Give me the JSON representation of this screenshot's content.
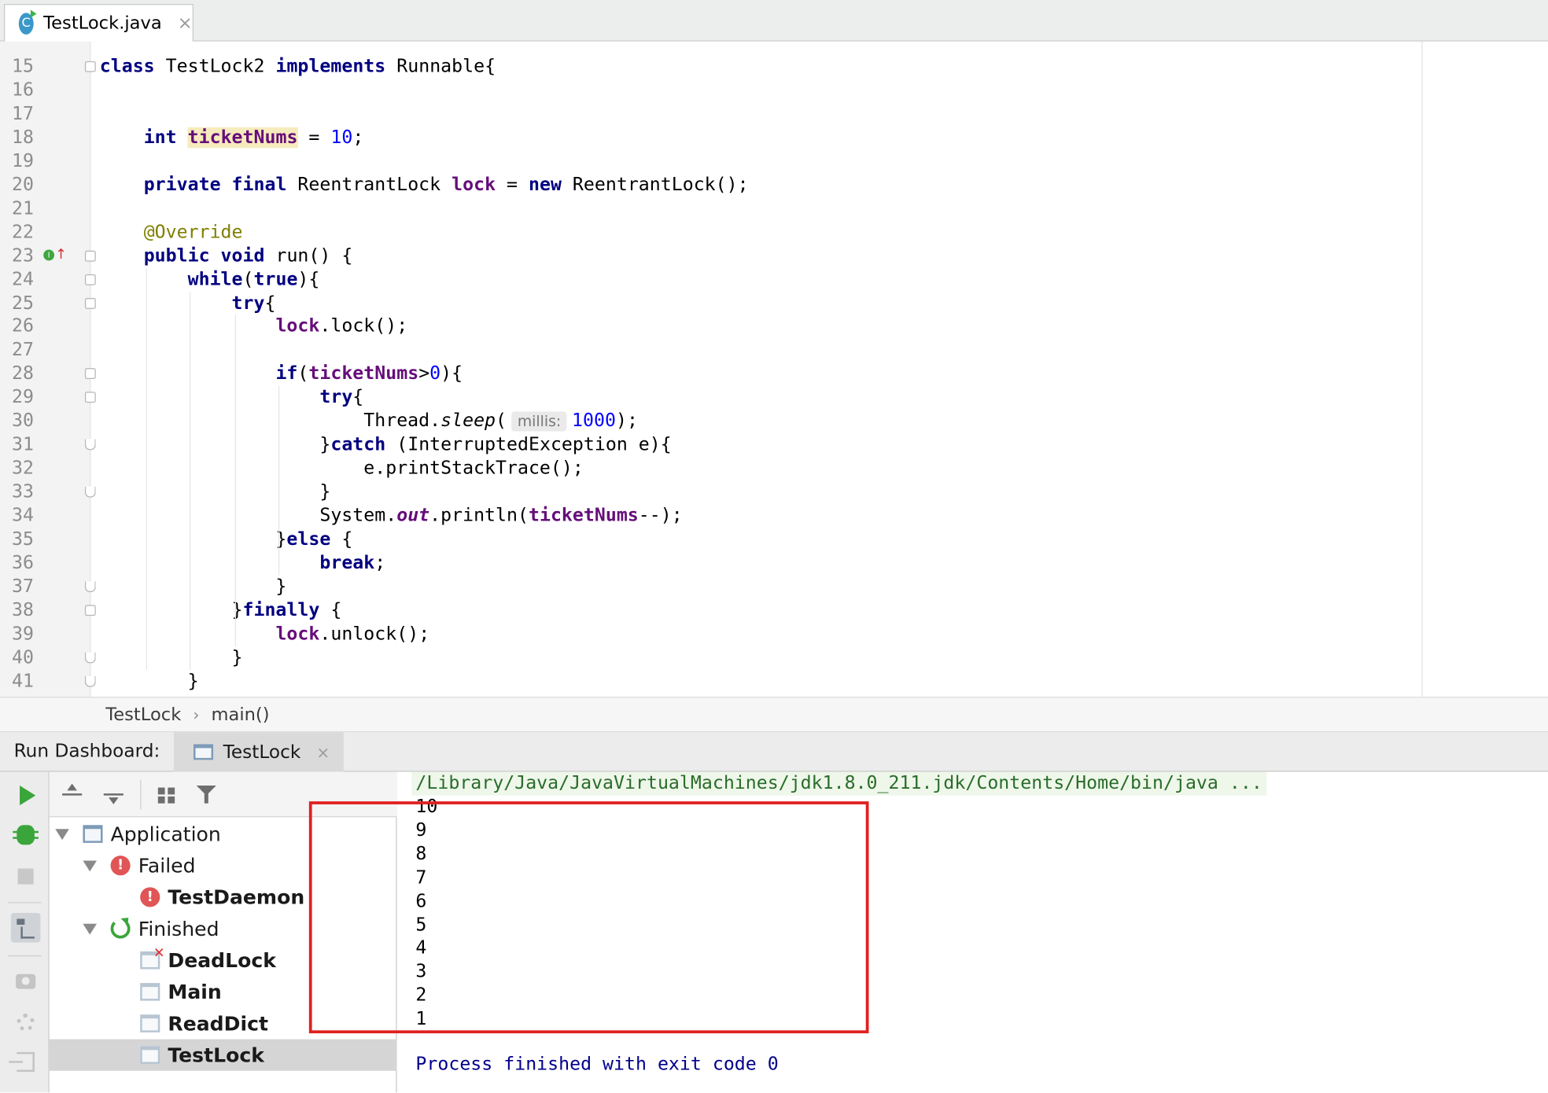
{
  "editor_tab": {
    "icon": "C",
    "label": "TestLock.java",
    "close": "×"
  },
  "code_lines": [
    {
      "n": "15",
      "html": "<span class=\"kw\">class</span> TestLock2 <span class=\"kw\">implements</span> Runnable{"
    },
    {
      "n": "16",
      "html": ""
    },
    {
      "n": "17",
      "html": ""
    },
    {
      "n": "18",
      "html": "    <span class=\"kw\">int</span> <span class=\"fld hl\">ticketNums</span> = <span class=\"num\">10</span>;"
    },
    {
      "n": "19",
      "html": ""
    },
    {
      "n": "20",
      "html": "    <span class=\"kw\">private final</span> ReentrantLock <span class=\"fld\">lock</span> = <span class=\"kw\">new</span> ReentrantLock();"
    },
    {
      "n": "21",
      "html": ""
    },
    {
      "n": "22",
      "html": "    <span class=\"ann\">@Override</span>"
    },
    {
      "n": "23",
      "html": "    <span class=\"kw\">public void</span> run() {"
    },
    {
      "n": "24",
      "html": "        <span class=\"kw\">while</span>(<span class=\"kw\">true</span>){"
    },
    {
      "n": "25",
      "html": "            <span class=\"kw\">try</span>{"
    },
    {
      "n": "26",
      "html": "                <span class=\"fld\">lock</span>.lock();"
    },
    {
      "n": "27",
      "html": ""
    },
    {
      "n": "28",
      "html": "                <span class=\"kw\">if</span>(<span class=\"fld\">ticketNums</span>&gt;<span class=\"num\">0</span>){"
    },
    {
      "n": "29",
      "html": "                    <span class=\"kw\">try</span>{"
    },
    {
      "n": "30",
      "html": "                        Thread.<span class=\"ital\">sleep</span>(<span class=\"hint\">millis:</span><span class=\"num\">1000</span>);"
    },
    {
      "n": "31",
      "html": "                    }<span class=\"kw\">catch</span> (InterruptedException e){"
    },
    {
      "n": "32",
      "html": "                        e.printStackTrace();"
    },
    {
      "n": "33",
      "html": "                    }"
    },
    {
      "n": "34",
      "html": "                    System.<span class=\"fld ital\">out</span>.println(<span class=\"fld\">ticketNums</span>--);"
    },
    {
      "n": "35",
      "html": "                }<span class=\"kw\">else</span> {"
    },
    {
      "n": "36",
      "html": "                    <span class=\"kw\">break</span>;"
    },
    {
      "n": "37",
      "html": "                }"
    },
    {
      "n": "38",
      "html": "            }<span class=\"kw\">finally</span> {"
    },
    {
      "n": "39",
      "html": "                <span class=\"fld\">lock</span>.unlock();"
    },
    {
      "n": "40",
      "html": "            }"
    },
    {
      "n": "41",
      "html": "        }"
    }
  ],
  "breadcrumb": {
    "items": [
      "TestLock",
      "main()"
    ],
    "separator": "›"
  },
  "run_dashboard": {
    "title": "Run Dashboard:",
    "tab_label": "TestLock",
    "tab_close": "×"
  },
  "tree": {
    "application": "Application",
    "failed": "Failed",
    "failed_items": [
      "TestDaemon"
    ],
    "finished": "Finished",
    "finished_items": [
      "DeadLock",
      "Main",
      "ReadDict",
      "TestLock"
    ],
    "selected": "TestLock"
  },
  "console": {
    "command": "/Library/Java/JavaVirtualMachines/jdk1.8.0_211.jdk/Contents/Home/bin/java ...",
    "output": [
      "10",
      "9",
      "8",
      "7",
      "6",
      "5",
      "4",
      "3",
      "2",
      "1"
    ],
    "finish": "Process finished with exit code 0"
  },
  "colors": {
    "keyword": "#000080",
    "field": "#660e7a",
    "number": "#0000ff",
    "annotation": "#808000",
    "highlight_box": "#e02020"
  }
}
